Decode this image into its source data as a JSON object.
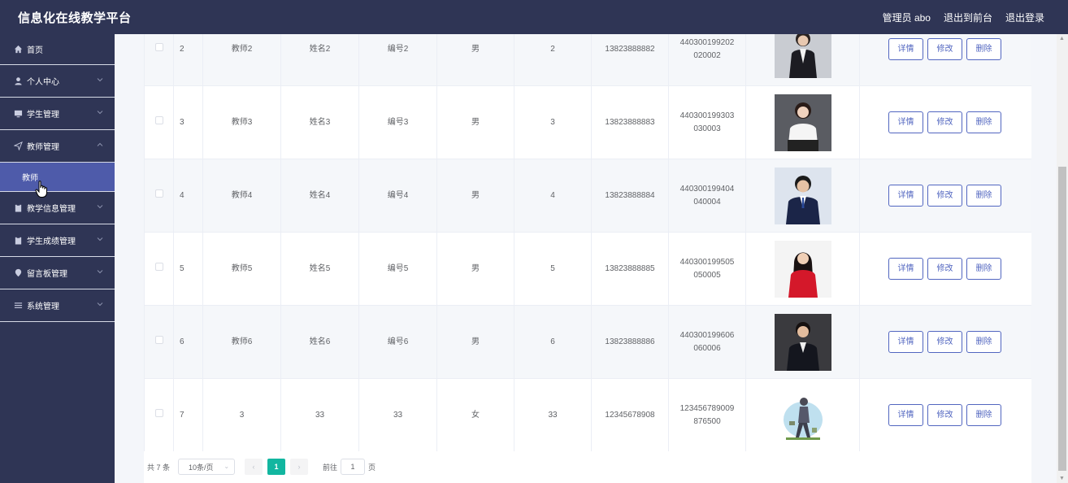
{
  "app": {
    "title": "信息化在线教学平台"
  },
  "header": {
    "user": "管理员 abo",
    "front": "退出到前台",
    "logout": "退出登录"
  },
  "sidebar": {
    "items": [
      {
        "label": "首页",
        "icon": "home-icon"
      },
      {
        "label": "个人中心",
        "icon": "user-icon"
      },
      {
        "label": "学生管理",
        "icon": "monitor-icon"
      },
      {
        "label": "教师管理",
        "icon": "send-icon"
      },
      {
        "label": "教学信息管理",
        "icon": "clipboard-icon"
      },
      {
        "label": "学生成绩管理",
        "icon": "clipboard-icon"
      },
      {
        "label": "留言板管理",
        "icon": "pin-icon"
      },
      {
        "label": "系统管理",
        "icon": "list-icon"
      }
    ],
    "active_sub": "教师"
  },
  "table": {
    "rows": [
      {
        "idx": "2",
        "account": "教师2",
        "name": "姓名2",
        "code": "编号2",
        "gender": "男",
        "age": "2",
        "phone": "13823888882",
        "id_no": "440300199202020002"
      },
      {
        "idx": "3",
        "account": "教师3",
        "name": "姓名3",
        "code": "编号3",
        "gender": "男",
        "age": "3",
        "phone": "13823888883",
        "id_no": "440300199303030003"
      },
      {
        "idx": "4",
        "account": "教师4",
        "name": "姓名4",
        "code": "编号4",
        "gender": "男",
        "age": "4",
        "phone": "13823888884",
        "id_no": "440300199404040004"
      },
      {
        "idx": "5",
        "account": "教师5",
        "name": "姓名5",
        "code": "编号5",
        "gender": "男",
        "age": "5",
        "phone": "13823888885",
        "id_no": "440300199505050005"
      },
      {
        "idx": "6",
        "account": "教师6",
        "name": "姓名6",
        "code": "编号6",
        "gender": "男",
        "age": "6",
        "phone": "13823888886",
        "id_no": "440300199606060006"
      },
      {
        "idx": "7",
        "account": "3",
        "name": "33",
        "code": "33",
        "gender": "女",
        "age": "33",
        "phone": "12345678908",
        "id_no": "123456789009876500"
      }
    ],
    "actions": {
      "detail": "详情",
      "edit": "修改",
      "delete": "删除"
    }
  },
  "pagination": {
    "total": "共 7 条",
    "size": "10条/页",
    "current": "1",
    "goto_label": "前往",
    "goto_value": "1",
    "page_suffix": "页"
  },
  "colors": {
    "topbar": "#2f3555",
    "active": "#4e5baa",
    "accent": "#5266c0",
    "page": "#12b6a0"
  }
}
